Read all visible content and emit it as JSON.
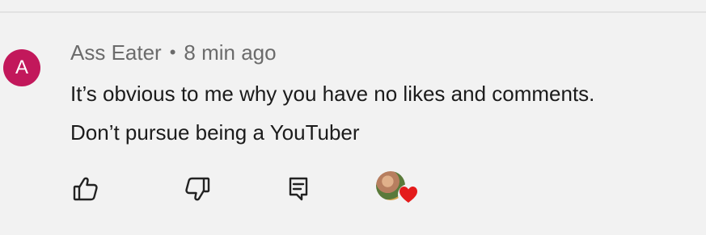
{
  "comment": {
    "avatar_letter": "A",
    "author": "Ass Eater",
    "separator": "•",
    "time": "8 min ago",
    "lines": [
      "It’s obvious to me why you have no likes and comments.",
      "Don’t pursue being a YouTuber"
    ]
  },
  "actions": {
    "like_icon": "thumbs-up-icon",
    "dislike_icon": "thumbs-down-icon",
    "reply_icon": "comment-reply-icon",
    "creator_heart_icon": "heart-icon"
  },
  "colors": {
    "avatar_bg": "#c2185b",
    "heart": "#e41b1b"
  }
}
